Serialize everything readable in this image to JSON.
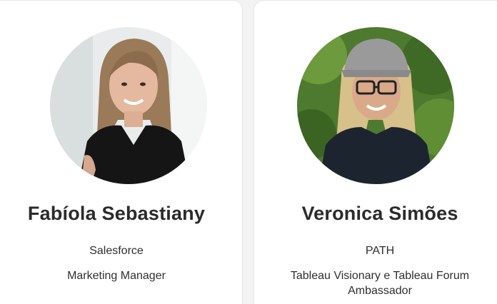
{
  "speakers": [
    {
      "name": "Fabíola Sebastiany",
      "company": "Salesforce",
      "role": "Marketing Manager"
    },
    {
      "name": "Veronica Simões",
      "company": "PATH",
      "role": "Tableau Visionary e Tableau Forum Ambassador"
    }
  ]
}
